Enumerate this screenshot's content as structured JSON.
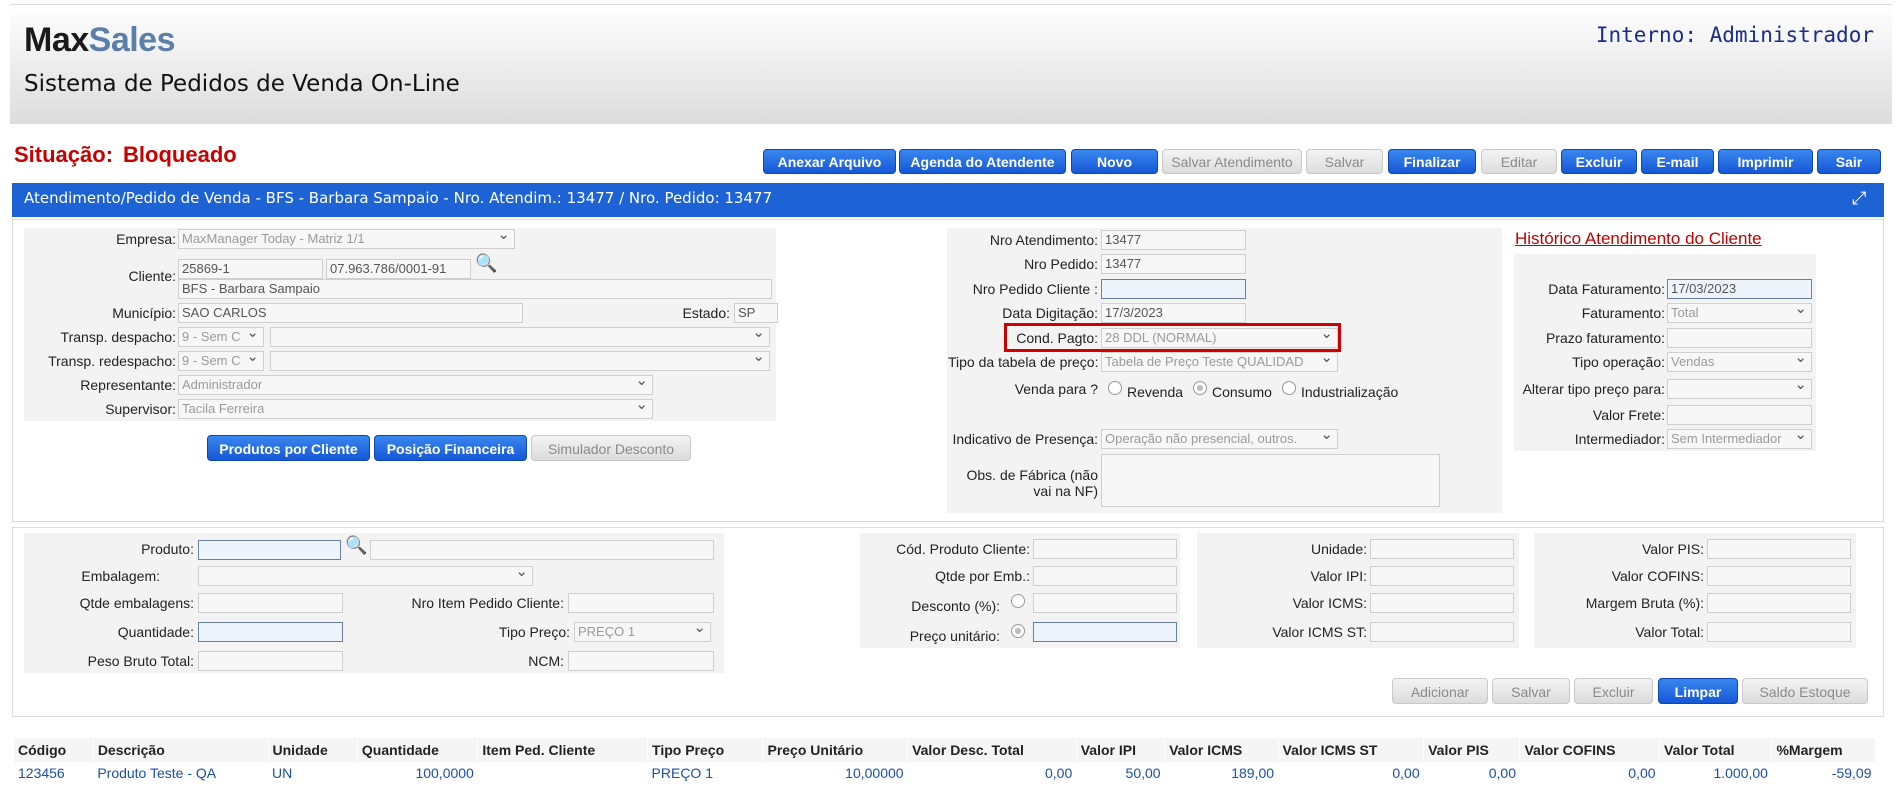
{
  "header": {
    "logo_max": "Max",
    "logo_sales": "Sales",
    "subtitle": "Sistema de Pedidos de Venda On-Line",
    "user": "Interno: Administrador"
  },
  "status": {
    "label": "Situação:",
    "value": "Bloqueado"
  },
  "toolbar": [
    {
      "label": "Anexar Arquivo",
      "enabled": true
    },
    {
      "label": "Agenda do Atendente",
      "enabled": true
    },
    {
      "label": "Novo",
      "enabled": true
    },
    {
      "label": "Salvar Atendimento",
      "enabled": false
    },
    {
      "label": "Salvar",
      "enabled": false
    },
    {
      "label": "Finalizar",
      "enabled": true
    },
    {
      "label": "Editar",
      "enabled": false
    },
    {
      "label": "Excluir",
      "enabled": true
    },
    {
      "label": "E-mail",
      "enabled": true
    },
    {
      "label": "Imprimir",
      "enabled": true
    },
    {
      "label": "Sair",
      "enabled": true
    }
  ],
  "title_bar": "Atendimento/Pedido de Venda - BFS - Barbara Sampaio - Nro. Atendim.: 13477 / Nro. Pedido: 13477",
  "left": {
    "empresa_label": "Empresa:",
    "empresa": "MaxManager Today - Matriz 1/1",
    "cliente_label": "Cliente:",
    "cliente_code": "25869-1",
    "cliente_cnpj": "07.963.786/0001-91",
    "cliente_name": "BFS - Barbara Sampaio",
    "municipio_label": "Município:",
    "municipio": "SAO CARLOS",
    "estado_label": "Estado:",
    "estado": "SP",
    "transp_despacho_label": "Transp. despacho:",
    "transp_despacho": "9 - Sem C",
    "transp_redespacho_label": "Transp. redespacho:",
    "transp_redespacho": "9 - Sem C",
    "representante_label": "Representante:",
    "representante": "Administrador",
    "supervisor_label": "Supervisor:",
    "supervisor": "Tacila Ferreira",
    "btn_produtos": "Produtos por Cliente",
    "btn_posicao": "Posição Financeira",
    "btn_simulador": "Simulador Desconto"
  },
  "middle": {
    "nro_atend_label": "Nro Atendimento:",
    "nro_atend": "13477",
    "nro_pedido_label": "Nro Pedido:",
    "nro_pedido": "13477",
    "nro_pedido_cliente_label": "Nro Pedido Cliente :",
    "nro_pedido_cliente": "",
    "data_digitacao_label": "Data Digitação:",
    "data_digitacao": "17/3/2023",
    "cond_pagto_label": "Cond. Pagto:",
    "cond_pagto": "28 DDL (NORMAL)",
    "tabela_preco_label": "Tipo da tabela de preço:",
    "tabela_preco": "Tabela de Preço Teste QUALIDAD",
    "venda_para_label": "Venda para ?",
    "opt_revenda": "Revenda",
    "opt_consumo": "Consumo",
    "opt_industrializacao": "Industrialização",
    "indicativo_label": "Indicativo de Presença:",
    "indicativo": "Operação não presencial, outros.",
    "obs_label_1": "Obs. de Fábrica (não",
    "obs_label_2": "vai na NF)"
  },
  "right": {
    "historico_link": "Histórico Atendimento do Cliente",
    "data_fat_label": "Data Faturamento:",
    "data_fat": "17/03/2023",
    "faturamento_label": "Faturamento:",
    "faturamento": "Total",
    "prazo_label": "Prazo faturamento:",
    "prazo": "",
    "tipo_op_label": "Tipo operação:",
    "tipo_op": "Vendas",
    "alterar_label": "Alterar tipo preço para:",
    "alterar": "",
    "frete_label": "Valor Frete:",
    "frete": "",
    "intermediador_label": "Intermediador:",
    "intermediador": "Sem Intermediador"
  },
  "item": {
    "produto_label": "Produto:",
    "embalagem_label": "Embalagem:",
    "qtde_emb_label": "Qtde embalagens:",
    "nro_item_label": "Nro Item Pedido Cliente:",
    "quantidade_label": "Quantidade:",
    "tipo_preco_label": "Tipo Preço:",
    "tipo_preco": "PREÇO 1",
    "peso_label": "Peso Bruto Total:",
    "ncm_label": "NCM:",
    "cod_prod_cli_label": "Cód. Produto Cliente:",
    "qtde_por_emb_label": "Qtde por Emb.:",
    "desconto_label": "Desconto (%):",
    "preco_unit_label": "Preço unitário:",
    "unidade_label": "Unidade:",
    "valor_ipi_label": "Valor IPI:",
    "valor_icms_label": "Valor ICMS:",
    "valor_icms_st_label": "Valor ICMS ST:",
    "valor_pis_label": "Valor PIS:",
    "valor_cofins_label": "Valor COFINS:",
    "margem_label": "Margem Bruta (%):",
    "valor_total_label": "Valor Total:",
    "btn_adicionar": "Adicionar",
    "btn_salvar": "Salvar",
    "btn_excluir": "Excluir",
    "btn_limpar": "Limpar",
    "btn_saldo": "Saldo Estoque"
  },
  "table": {
    "headers": [
      "Código",
      "Descrição",
      "Unidade",
      "Quantidade",
      "Item Ped. Cliente",
      "Tipo Preço",
      "Preço Unitário",
      "Valor Desc. Total",
      "Valor IPI",
      "Valor ICMS",
      "Valor ICMS ST",
      "Valor PIS",
      "Valor COFINS",
      "Valor Total",
      "%Margem"
    ],
    "rows": [
      [
        "123456",
        "Produto Teste - QA",
        "UN",
        "100,0000",
        "",
        "PREÇO 1",
        "10,00000",
        "0,00",
        "50,00",
        "189,00",
        "0,00",
        "0,00",
        "0,00",
        "1.000,00",
        "-59,09"
      ]
    ]
  }
}
